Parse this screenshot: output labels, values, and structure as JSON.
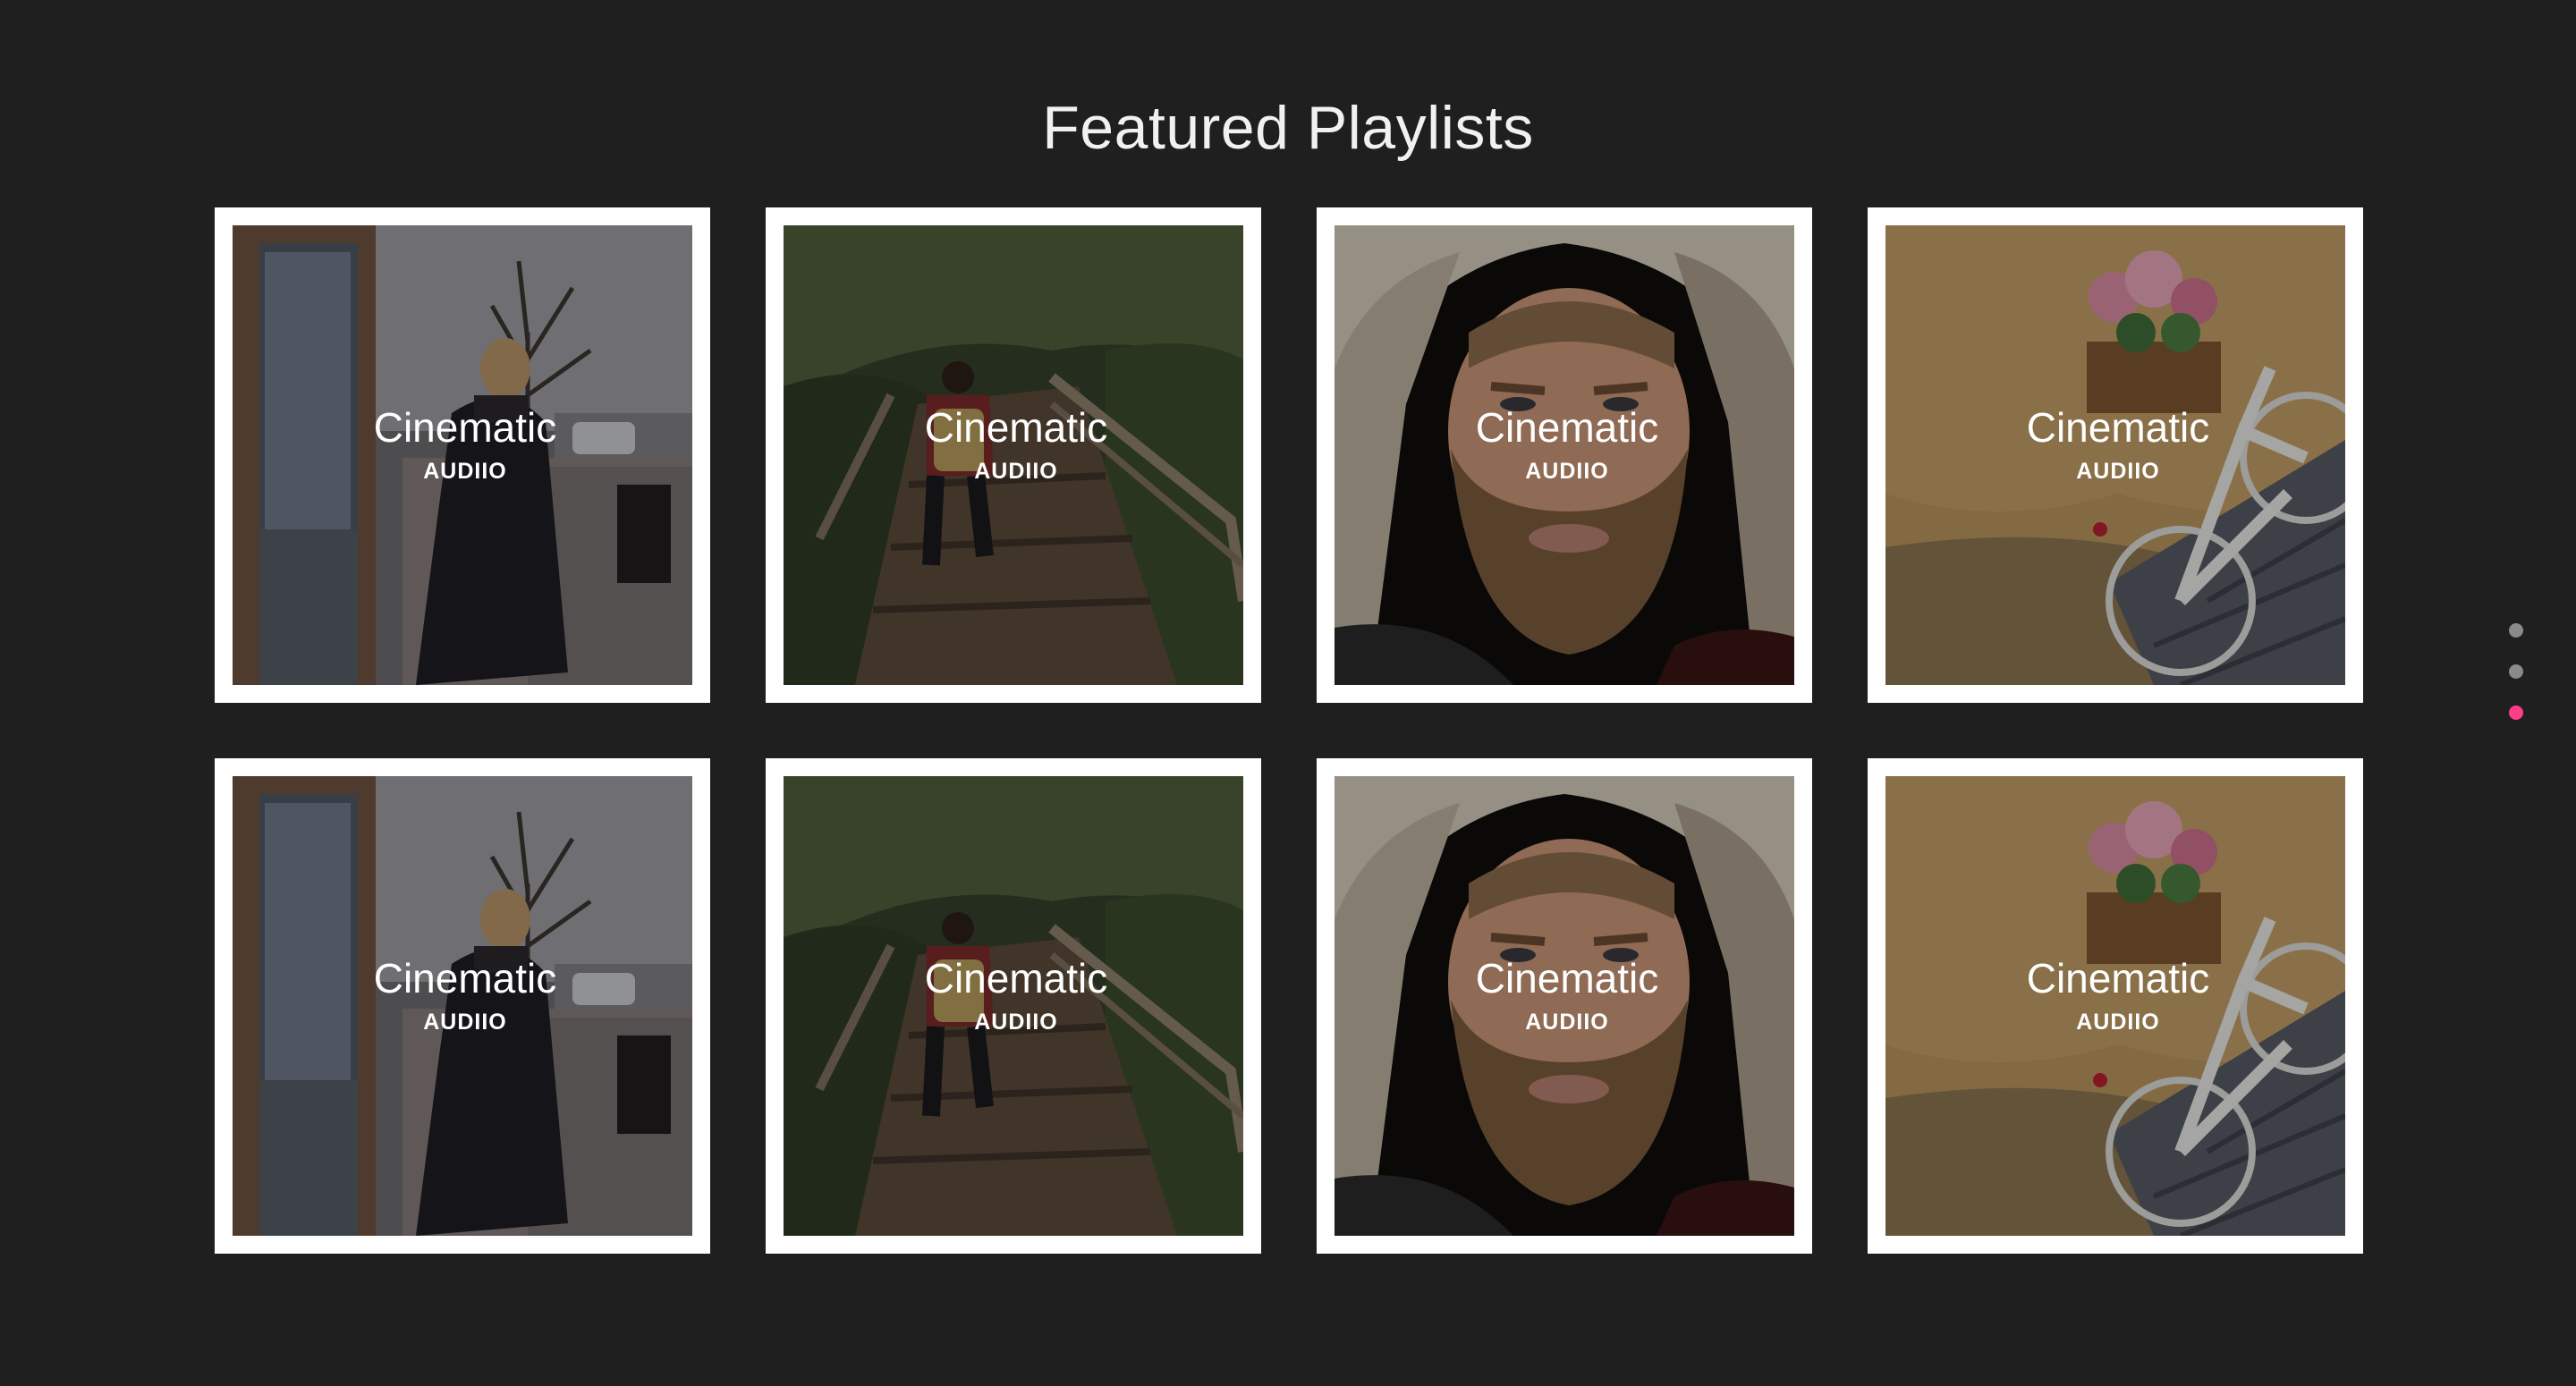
{
  "section": {
    "title": "Featured Playlists"
  },
  "playlists": [
    {
      "title": "Cinematic",
      "subtitle": "AUDIIO",
      "art": "woman-walking-city-street"
    },
    {
      "title": "Cinematic",
      "subtitle": "AUDIIO",
      "art": "hiker-on-wooden-stairs"
    },
    {
      "title": "Cinematic",
      "subtitle": "AUDIIO",
      "art": "bearded-man-fur-hood"
    },
    {
      "title": "Cinematic",
      "subtitle": "AUDIIO",
      "art": "bicycle-with-flowers"
    },
    {
      "title": "Cinematic",
      "subtitle": "AUDIIO",
      "art": "woman-walking-city-street"
    },
    {
      "title": "Cinematic",
      "subtitle": "AUDIIO",
      "art": "hiker-on-wooden-stairs"
    },
    {
      "title": "Cinematic",
      "subtitle": "AUDIIO",
      "art": "bearded-man-fur-hood"
    },
    {
      "title": "Cinematic",
      "subtitle": "AUDIIO",
      "art": "bicycle-with-flowers"
    }
  ],
  "pagination": {
    "pages": 3,
    "active_index": 2,
    "dot_color": "#8a8a8a",
    "active_color": "#ff3d8b"
  },
  "colors": {
    "background": "#1f1f1f",
    "card_border": "#ffffff",
    "text": "#ffffff"
  }
}
